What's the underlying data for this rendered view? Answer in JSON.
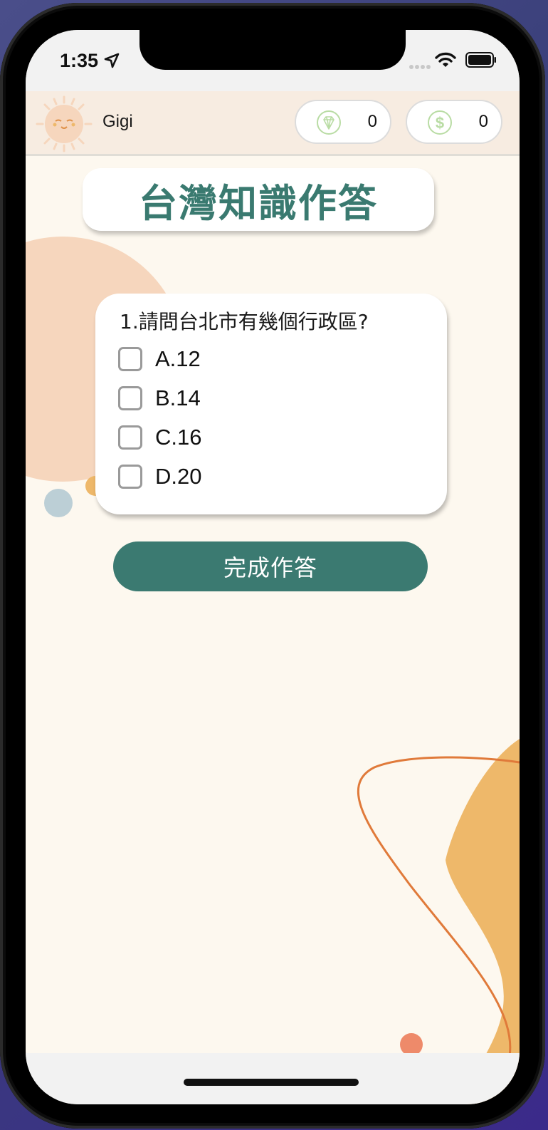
{
  "status_bar": {
    "time": "1:35"
  },
  "header": {
    "username": "Gigi",
    "diamond": {
      "icon": "diamond-icon",
      "value": "0"
    },
    "coins": {
      "icon": "dollar-coin-icon",
      "value": "0"
    }
  },
  "quiz": {
    "title": "台灣知識作答",
    "question": "1.請問台北市有幾個行政區?",
    "options": [
      {
        "label": "A.12"
      },
      {
        "label": "B.14"
      },
      {
        "label": "C.16"
      },
      {
        "label": "D.20"
      }
    ],
    "submit_label": "完成作答"
  },
  "colors": {
    "accent": "#3b7a71",
    "background": "#fdf8ef",
    "header_bg": "#f7ece1",
    "deco_peach": "#f6d6bd",
    "deco_orange": "#eeb86a",
    "deco_line": "#e07a3a"
  }
}
